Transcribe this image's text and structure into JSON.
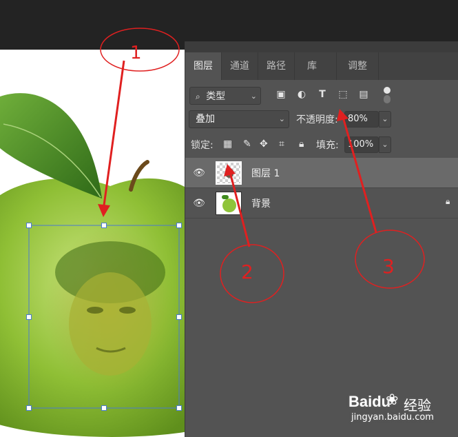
{
  "panel": {
    "tabs": [
      {
        "label": "图层"
      },
      {
        "label": "通道"
      },
      {
        "label": "路径"
      },
      {
        "label": "库"
      },
      {
        "label": "调整"
      }
    ],
    "filter": {
      "label": "类型",
      "icons": [
        "image-icon",
        "adjustment-icon",
        "text-icon",
        "shape-icon",
        "smart-object-icon"
      ]
    },
    "blend_mode": "叠加",
    "opacity": {
      "label": "不透明度:",
      "value": "80%"
    },
    "lock": {
      "label": "锁定:"
    },
    "fill": {
      "label": "填充:",
      "value": "100%"
    },
    "layers": [
      {
        "name": "图层 1",
        "selected": true
      },
      {
        "name": "背景",
        "selected": false,
        "locked": true
      }
    ]
  },
  "annotations": [
    {
      "number": "1"
    },
    {
      "number": "2"
    },
    {
      "number": "3"
    }
  ],
  "watermark": {
    "brand": "Baidu",
    "service": "经验",
    "url": "jingyan.baidu.com"
  },
  "colors": {
    "annotation_red": "#e02020",
    "transform_box": "#4a7bd0",
    "apple_green": "#8fc43a",
    "panel_bg": "#535353",
    "selected_layer": "#6a6a6a"
  }
}
